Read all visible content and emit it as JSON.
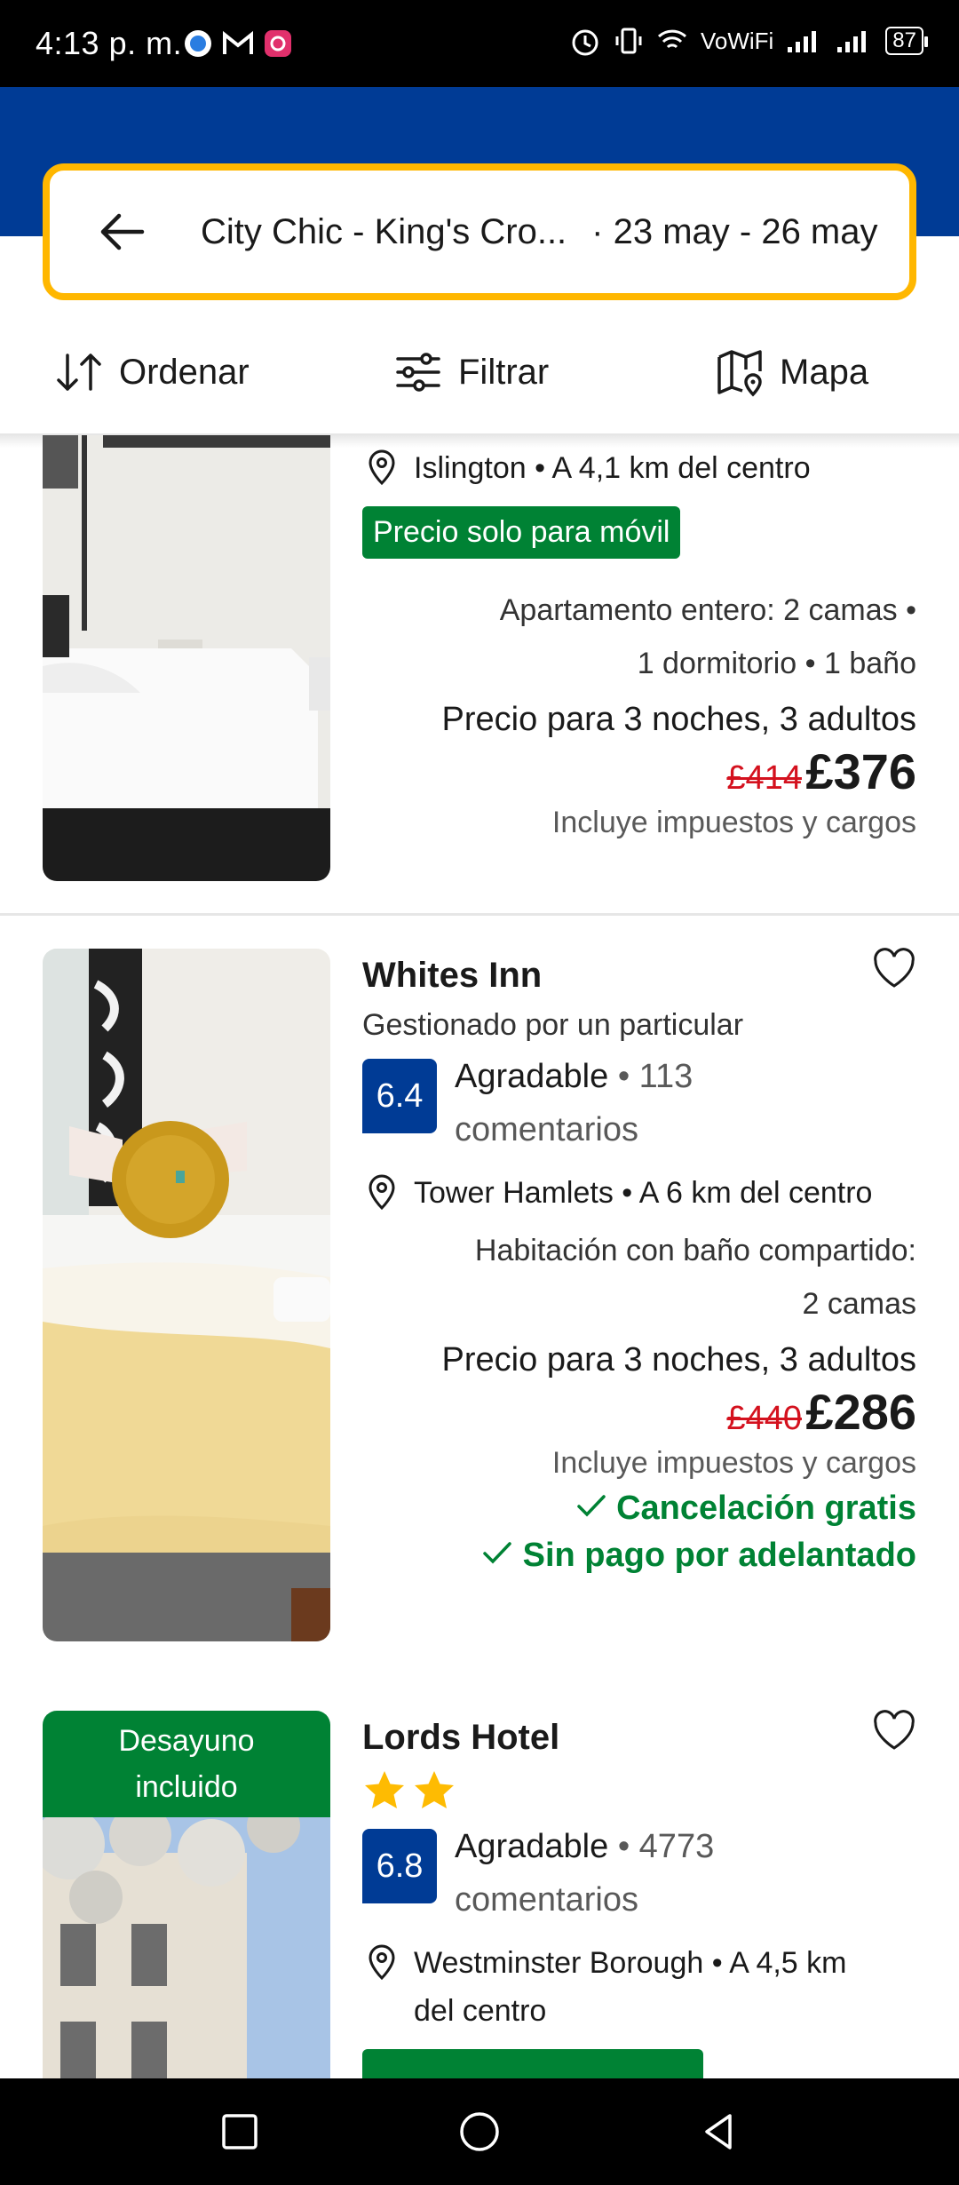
{
  "status_bar": {
    "time": "4:13 p. m.",
    "network": "VoWiFi",
    "battery": "87"
  },
  "search": {
    "destination": "City Chic - King's Cro...",
    "dates": "· 23 may - 26 may"
  },
  "toolbar": {
    "sort_label": "Ordenar",
    "filter_label": "Filtrar",
    "map_label": "Mapa"
  },
  "listings": [
    {
      "location": "Islington • A 4,1 km del centro",
      "tag": "Precio solo para móvil",
      "room_line1": "Apartamento entero: 2 camas •",
      "room_line2": "1 dormitorio • 1 baño",
      "price_for": "Precio para 3 noches, 3 adultos",
      "old_price": "£414",
      "price": "£376",
      "taxes": "Incluye impuestos y cargos"
    },
    {
      "name": "Whites Inn",
      "host": "Gestionado por un particular",
      "score": "6.4",
      "rating_word": "Agradable",
      "reviews_count": "• 113",
      "reviews_word": "comentarios",
      "location": "Tower Hamlets • A 6 km del centro",
      "room_line1": "Habitación con baño compartido:",
      "room_line2": "2 camas",
      "price_for": "Precio para 3 noches, 3 adultos",
      "old_price": "£440",
      "price": "£286",
      "taxes": "Incluye impuestos y cargos",
      "perk1": "Cancelación gratis",
      "perk2": "Sin pago por adelantado"
    },
    {
      "name": "Lords Hotel",
      "badge_line1": "Desayuno",
      "badge_line2": "incluido",
      "stars": 2,
      "score": "6.8",
      "rating_word": "Agradable",
      "reviews_count": "• 4773",
      "reviews_word": "comentarios",
      "location_line1": "Westminster Borough • A 4,5 km",
      "location_line2": "del centro"
    }
  ],
  "colors": {
    "brand_blue": "#003b95",
    "search_border": "#ffb700",
    "green": "#008234",
    "price_red": "#d4111e",
    "star": "#febb02"
  }
}
